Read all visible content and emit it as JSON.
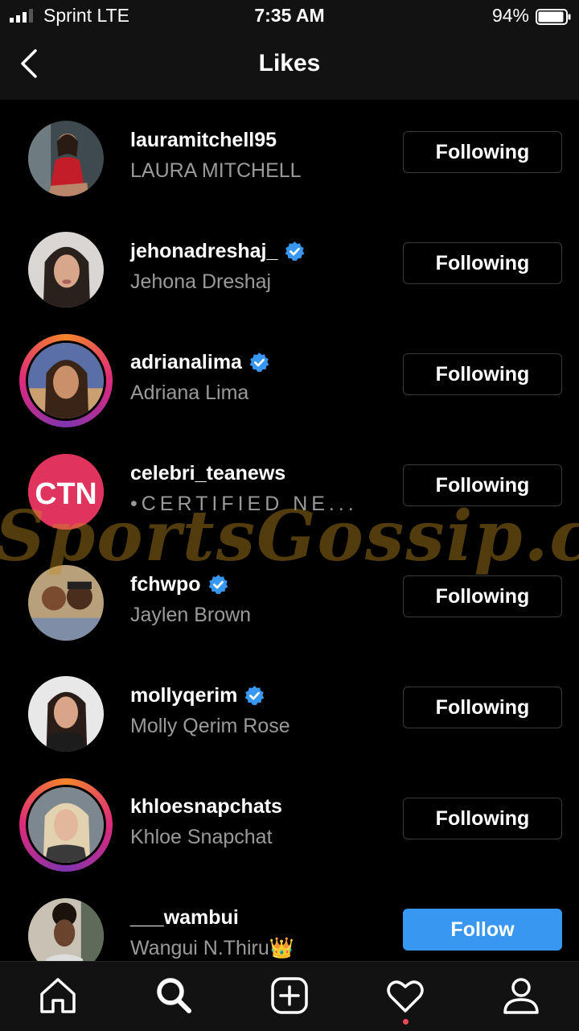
{
  "status_bar": {
    "carrier": "Sprint  LTE",
    "time": "7:35 AM",
    "battery_percent": "94%",
    "battery_level": 0.94
  },
  "header": {
    "title": "Likes",
    "back_icon": "chevron-left-icon"
  },
  "users": [
    {
      "username": "lauramitchell95",
      "full_name": "LAURA MITCHELL",
      "verified": false,
      "button": "Following",
      "story_ring": false
    },
    {
      "username": "jehonadreshaj_",
      "full_name": "Jehona Dreshaj",
      "verified": true,
      "button": "Following",
      "story_ring": false
    },
    {
      "username": "adrianalima",
      "full_name": "Adriana Lima",
      "verified": true,
      "button": "Following",
      "story_ring": true
    },
    {
      "username": "celebri_teanews",
      "full_name": "•CERTIFIED NE...",
      "verified": false,
      "button": "Following",
      "story_ring": false,
      "avatar_text": "CTN"
    },
    {
      "username": "fchwpo",
      "full_name": "Jaylen Brown",
      "verified": true,
      "button": "Following",
      "story_ring": false
    },
    {
      "username": "mollyqerim",
      "full_name": "Molly Qerim Rose",
      "verified": true,
      "button": "Following",
      "story_ring": false
    },
    {
      "username": "khloesnapchats",
      "full_name": "Khloe Snapchat",
      "verified": false,
      "button": "Following",
      "story_ring": true
    },
    {
      "username": "___wambui",
      "full_name": "Wangui N.Thiru👑",
      "verified": false,
      "button": "Follow",
      "story_ring": false
    }
  ],
  "watermark": "SportsGossip.com",
  "tab_bar": [
    "home-icon",
    "search-icon",
    "new-post-icon",
    "activity-heart-icon",
    "profile-icon"
  ],
  "colors": {
    "background": "#000000",
    "bar": "#121212",
    "follow_button": "#3897f0",
    "verified_badge": "#3897f0",
    "secondary_text": "#9a9a9a"
  }
}
